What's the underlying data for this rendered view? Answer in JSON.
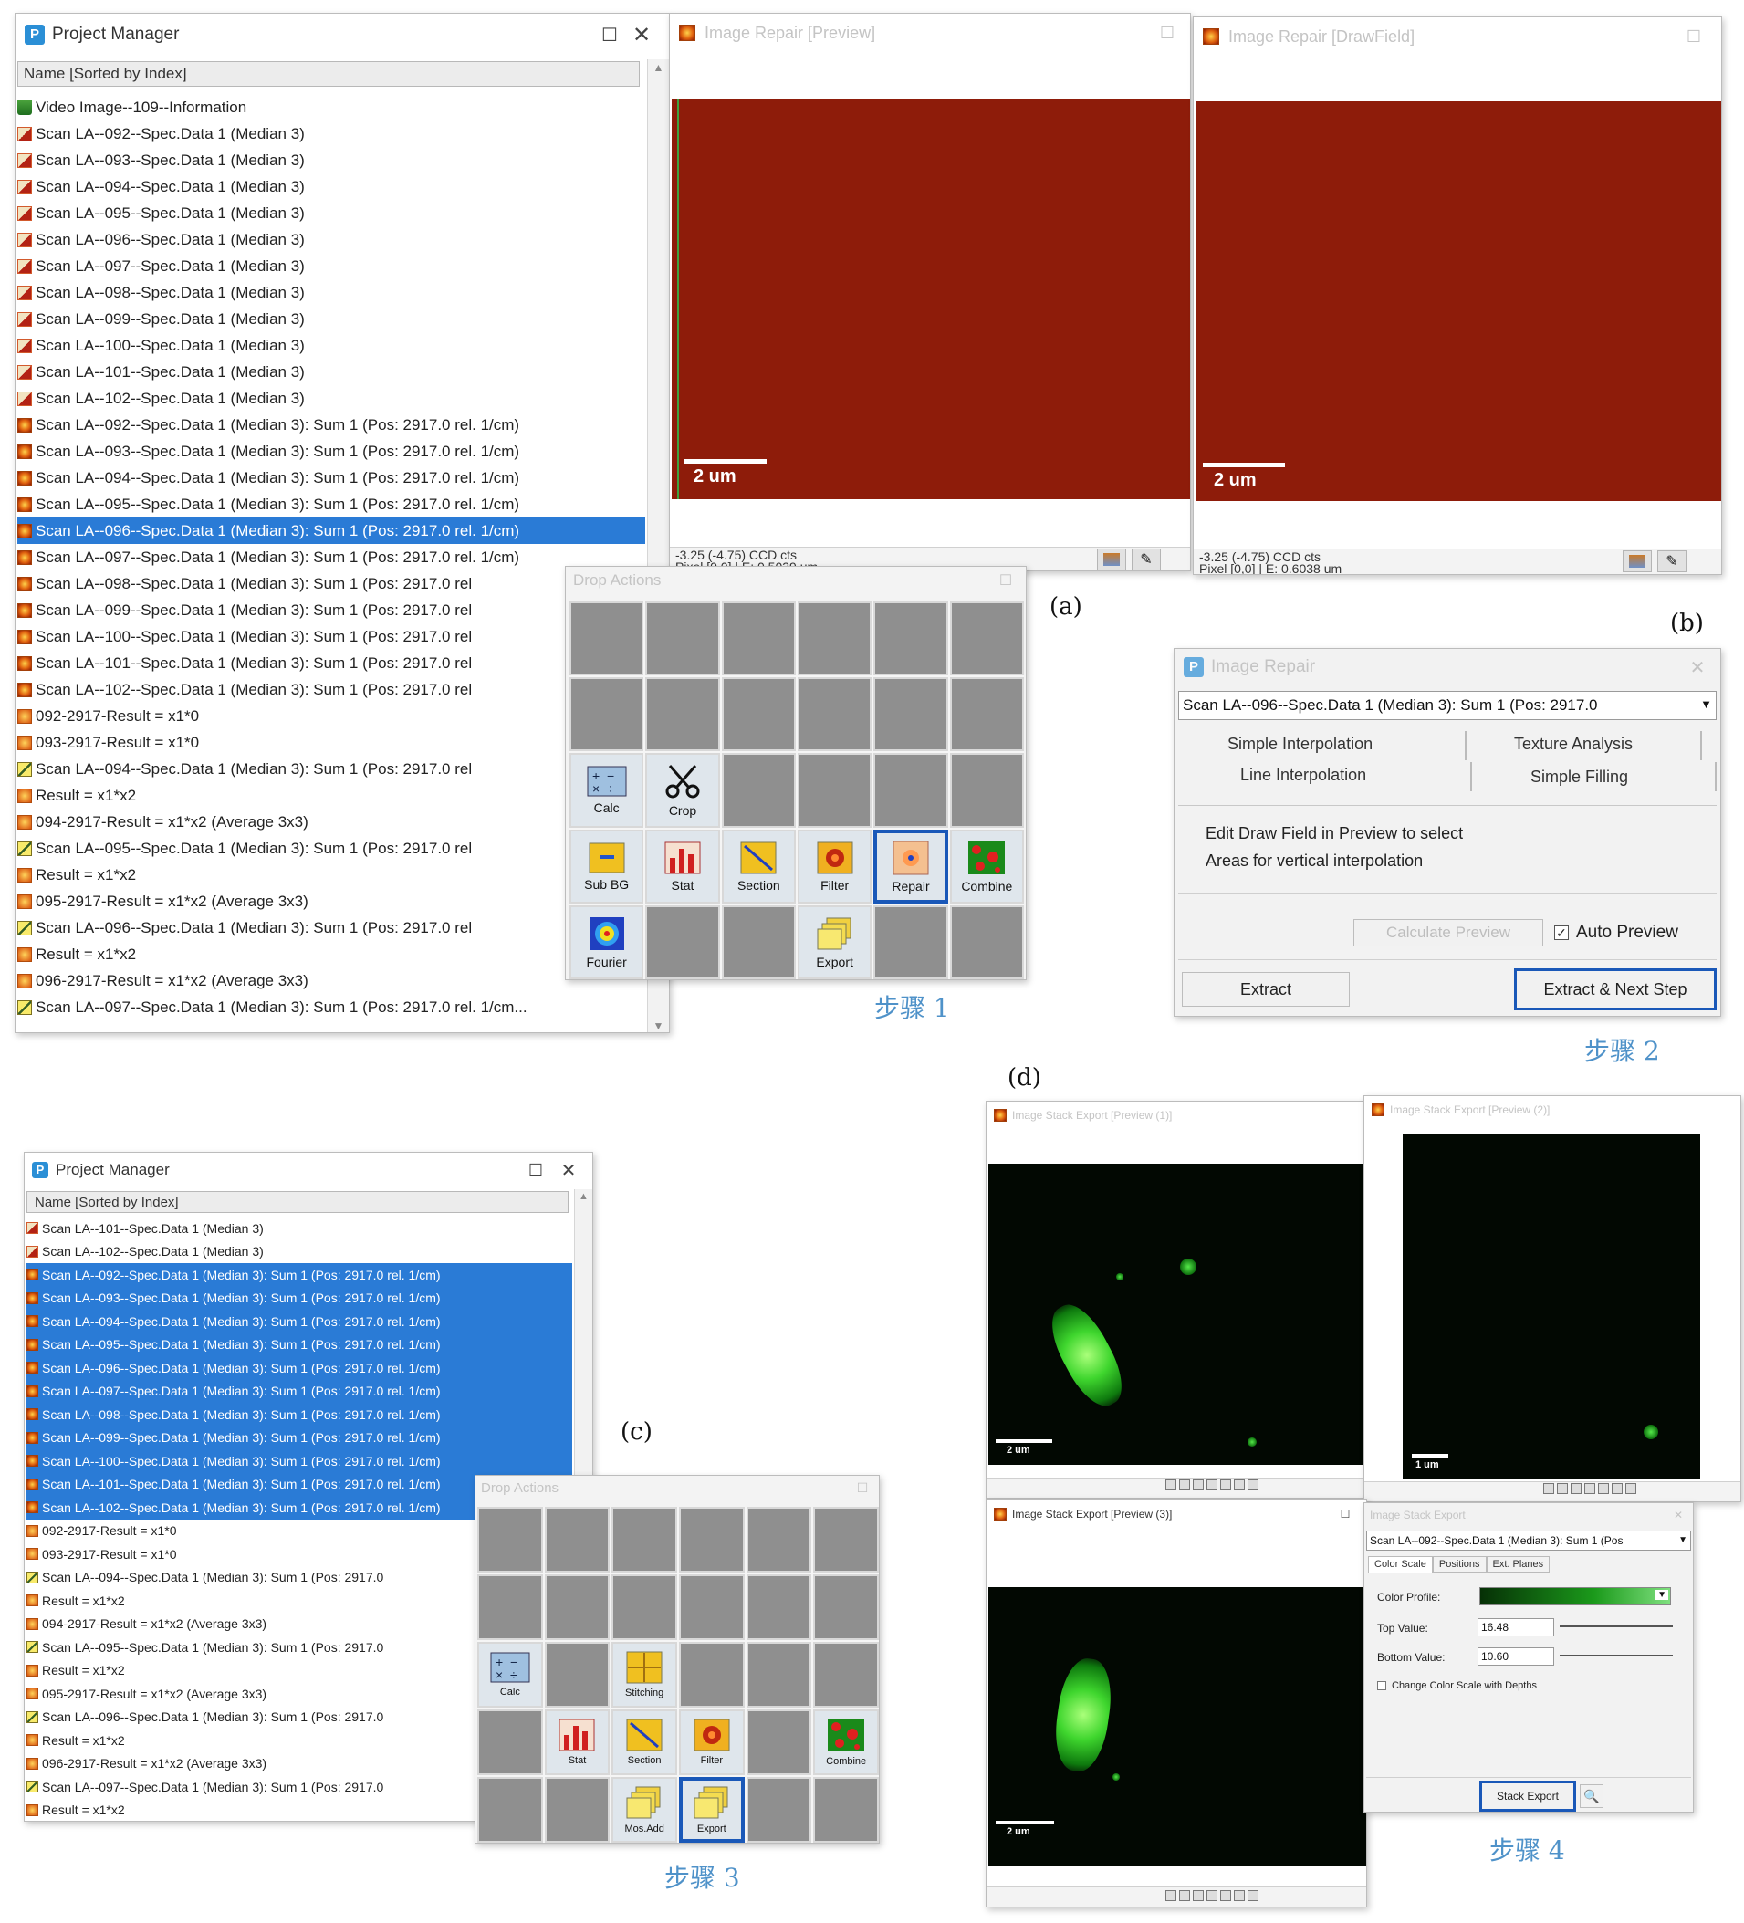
{
  "panel_labels": {
    "a": "(a)",
    "b": "(b)",
    "c": "(c)",
    "d": "(d)"
  },
  "steps": {
    "s1": "步骤 1",
    "s2": "步骤 2",
    "s3": "步骤 3",
    "s4": "步骤 4"
  },
  "pm_top": {
    "title": "Project Manager",
    "column_header": "Name [Sorted by Index]",
    "items": [
      {
        "text": "Video Image--109--Information",
        "icon": "info"
      },
      {
        "text": "Scan LA--092--Spec.Data 1 (Median 3)",
        "icon": "scan"
      },
      {
        "text": "Scan LA--093--Spec.Data 1 (Median 3)",
        "icon": "scan"
      },
      {
        "text": "Scan LA--094--Spec.Data 1 (Median 3)",
        "icon": "scan"
      },
      {
        "text": "Scan LA--095--Spec.Data 1 (Median 3)",
        "icon": "scan"
      },
      {
        "text": "Scan LA--096--Spec.Data 1 (Median 3)",
        "icon": "scan"
      },
      {
        "text": "Scan LA--097--Spec.Data 1 (Median 3)",
        "icon": "scan"
      },
      {
        "text": "Scan LA--098--Spec.Data 1 (Median 3)",
        "icon": "scan"
      },
      {
        "text": "Scan LA--099--Spec.Data 1 (Median 3)",
        "icon": "scan"
      },
      {
        "text": "Scan LA--100--Spec.Data 1 (Median 3)",
        "icon": "scan"
      },
      {
        "text": "Scan LA--101--Spec.Data 1 (Median 3)",
        "icon": "scan"
      },
      {
        "text": "Scan LA--102--Spec.Data 1 (Median 3)",
        "icon": "scan"
      },
      {
        "text": "Scan LA--092--Spec.Data 1 (Median 3): Sum 1 (Pos: 2917.0 rel. 1/cm)",
        "icon": "sum"
      },
      {
        "text": "Scan LA--093--Spec.Data 1 (Median 3): Sum 1 (Pos: 2917.0 rel. 1/cm)",
        "icon": "sum"
      },
      {
        "text": "Scan LA--094--Spec.Data 1 (Median 3): Sum 1 (Pos: 2917.0 rel. 1/cm)",
        "icon": "sum"
      },
      {
        "text": "Scan LA--095--Spec.Data 1 (Median 3): Sum 1 (Pos: 2917.0 rel. 1/cm)",
        "icon": "sum"
      },
      {
        "text": "Scan LA--096--Spec.Data 1 (Median 3): Sum 1 (Pos: 2917.0 rel. 1/cm)",
        "icon": "sum",
        "selected": true
      },
      {
        "text": "Scan LA--097--Spec.Data 1 (Median 3): Sum 1 (Pos: 2917.0 rel. 1/cm)",
        "icon": "sum"
      },
      {
        "text": "Scan LA--098--Spec.Data 1 (Median 3): Sum 1 (Pos: 2917.0 rel",
        "icon": "sum"
      },
      {
        "text": "Scan LA--099--Spec.Data 1 (Median 3): Sum 1 (Pos: 2917.0 rel",
        "icon": "sum"
      },
      {
        "text": "Scan LA--100--Spec.Data 1 (Median 3): Sum 1 (Pos: 2917.0 rel",
        "icon": "sum"
      },
      {
        "text": "Scan LA--101--Spec.Data 1 (Median 3): Sum 1 (Pos: 2917.0 rel",
        "icon": "sum"
      },
      {
        "text": "Scan LA--102--Spec.Data 1 (Median 3): Sum 1 (Pos: 2917.0 rel",
        "icon": "sum"
      },
      {
        "text": "092-2917-Result = x1*0",
        "icon": "res"
      },
      {
        "text": "093-2917-Result = x1*0",
        "icon": "res"
      },
      {
        "text": "Scan LA--094--Spec.Data 1 (Median 3): Sum 1 (Pos: 2917.0 rel",
        "icon": "chan"
      },
      {
        "text": "Result = x1*x2",
        "icon": "res"
      },
      {
        "text": "094-2917-Result = x1*x2 (Average 3x3)",
        "icon": "res"
      },
      {
        "text": "Scan LA--095--Spec.Data 1 (Median 3): Sum 1 (Pos: 2917.0 rel",
        "icon": "chan"
      },
      {
        "text": "Result = x1*x2",
        "icon": "res"
      },
      {
        "text": "095-2917-Result = x1*x2 (Average 3x3)",
        "icon": "res"
      },
      {
        "text": "Scan LA--096--Spec.Data 1 (Median 3): Sum 1 (Pos: 2917.0 rel",
        "icon": "chan"
      },
      {
        "text": "Result = x1*x2",
        "icon": "res"
      },
      {
        "text": "096-2917-Result = x1*x2 (Average 3x3)",
        "icon": "res"
      },
      {
        "text": "Scan LA--097--Spec.Data 1 (Median 3): Sum 1 (Pos: 2917.0 rel. 1/cm...",
        "icon": "chan"
      }
    ]
  },
  "repair_preview": {
    "title": "Image Repair [Preview]",
    "scale": "2 um",
    "status1": "-3.25 (-4.75) CCD cts",
    "status2": "Pixel [0,0] | E: 0.5039 um"
  },
  "repair_drawfield": {
    "title": "Image Repair [DrawField]",
    "scale": "2 um",
    "status1": "-3.25 (-4.75) CCD cts",
    "status2": "Pixel [0,0] | E: 0.6038 um"
  },
  "drop_actions_1": {
    "title": "Drop Actions",
    "cells": [
      "",
      "",
      "",
      "",
      "",
      "",
      "",
      "",
      "",
      "",
      "",
      "",
      "Calc",
      "Crop",
      "",
      "",
      "",
      "",
      "Sub BG",
      "Stat",
      "Section",
      "Filter",
      "Repair",
      "Combine",
      "Fourier",
      "",
      "",
      "Export",
      "",
      ""
    ]
  },
  "image_repair": {
    "title": "Image Repair",
    "dropdown": "Scan LA--096--Spec.Data 1 (Median 3): Sum 1 (Pos: 2917.0",
    "tabs": [
      "Simple Interpolation",
      "Texture Analysis",
      "Line Interpolation",
      "Simple Filling"
    ],
    "desc1": "Edit Draw Field in Preview to select",
    "desc2": "Areas for vertical interpolation",
    "calc_preview": "Calculate Preview",
    "auto_preview": "Auto Preview",
    "auto_preview_checked": true,
    "extract": "Extract",
    "extract_next": "Extract & Next Step"
  },
  "pm_bottom": {
    "title": "Project Manager",
    "column_header": "Name [Sorted by Index]",
    "items": [
      {
        "text": "Scan LA--101--Spec.Data 1 (Median 3)",
        "icon": "scan"
      },
      {
        "text": "Scan LA--102--Spec.Data 1 (Median 3)",
        "icon": "scan"
      },
      {
        "text": "Scan LA--092--Spec.Data 1 (Median 3): Sum 1 (Pos: 2917.0 rel. 1/cm)",
        "icon": "sum",
        "selected": true
      },
      {
        "text": "Scan LA--093--Spec.Data 1 (Median 3): Sum 1 (Pos: 2917.0 rel. 1/cm)",
        "icon": "sum",
        "selected": true
      },
      {
        "text": "Scan LA--094--Spec.Data 1 (Median 3): Sum 1 (Pos: 2917.0 rel. 1/cm)",
        "icon": "sum",
        "selected": true
      },
      {
        "text": "Scan LA--095--Spec.Data 1 (Median 3): Sum 1 (Pos: 2917.0 rel. 1/cm)",
        "icon": "sum",
        "selected": true
      },
      {
        "text": "Scan LA--096--Spec.Data 1 (Median 3): Sum 1 (Pos: 2917.0 rel. 1/cm)",
        "icon": "sum",
        "selected": true
      },
      {
        "text": "Scan LA--097--Spec.Data 1 (Median 3): Sum 1 (Pos: 2917.0 rel. 1/cm)",
        "icon": "sum",
        "selected": true
      },
      {
        "text": "Scan LA--098--Spec.Data 1 (Median 3): Sum 1 (Pos: 2917.0 rel. 1/cm)",
        "icon": "sum",
        "selected": true
      },
      {
        "text": "Scan LA--099--Spec.Data 1 (Median 3): Sum 1 (Pos: 2917.0 rel. 1/cm)",
        "icon": "sum",
        "selected": true
      },
      {
        "text": "Scan LA--100--Spec.Data 1 (Median 3): Sum 1 (Pos: 2917.0 rel. 1/cm)",
        "icon": "sum",
        "selected": true
      },
      {
        "text": "Scan LA--101--Spec.Data 1 (Median 3): Sum 1 (Pos: 2917.0 rel. 1/cm)",
        "icon": "sum",
        "selected": true
      },
      {
        "text": "Scan LA--102--Spec.Data 1 (Median 3): Sum 1 (Pos: 2917.0 rel. 1/cm)",
        "icon": "sum",
        "selected": true
      },
      {
        "text": "092-2917-Result = x1*0",
        "icon": "res"
      },
      {
        "text": "093-2917-Result = x1*0",
        "icon": "res"
      },
      {
        "text": "Scan LA--094--Spec.Data 1 (Median 3): Sum 1 (Pos: 2917.0",
        "icon": "chan"
      },
      {
        "text": "Result = x1*x2",
        "icon": "res"
      },
      {
        "text": "094-2917-Result = x1*x2 (Average 3x3)",
        "icon": "res"
      },
      {
        "text": "Scan LA--095--Spec.Data 1 (Median 3): Sum 1 (Pos: 2917.0",
        "icon": "chan"
      },
      {
        "text": "Result = x1*x2",
        "icon": "res"
      },
      {
        "text": "095-2917-Result = x1*x2 (Average 3x3)",
        "icon": "res"
      },
      {
        "text": "Scan LA--096--Spec.Data 1 (Median 3): Sum 1 (Pos: 2917.0",
        "icon": "chan"
      },
      {
        "text": "Result = x1*x2",
        "icon": "res"
      },
      {
        "text": "096-2917-Result = x1*x2 (Average 3x3)",
        "icon": "res"
      },
      {
        "text": "Scan LA--097--Spec.Data 1 (Median 3): Sum 1 (Pos: 2917.0",
        "icon": "chan"
      },
      {
        "text": "Result = x1*x2",
        "icon": "res"
      }
    ]
  },
  "drop_actions_2": {
    "title": "Drop Actions",
    "cells": [
      "",
      "",
      "",
      "",
      "",
      "",
      "",
      "",
      "",
      "",
      "",
      "",
      "Calc",
      "",
      "Stitching",
      "",
      "",
      "",
      "",
      "Stat",
      "Section",
      "Filter",
      "",
      "Combine",
      "",
      "",
      "Mos.Add",
      "Export",
      "",
      ""
    ]
  },
  "stack_pc1": {
    "title": "Image Stack Export [Preview (1)]",
    "scale": "2 um"
  },
  "stack_pc2": {
    "title": "Image Stack Export [Preview (2)]",
    "scale": "1 um"
  },
  "stack_pc3": {
    "title": "Image Stack Export [Preview (3)]",
    "scale": "2 um"
  },
  "stack_export": {
    "title": "Image Stack Export",
    "dropdown": "Scan LA--092--Spec.Data 1 (Median 3): Sum 1 (Pos",
    "tabs": [
      "Color Scale",
      "Positions",
      "Ext. Planes"
    ],
    "color_profile_label": "Color Profile:",
    "top_value_label": "Top Value:",
    "top_value": "16.48",
    "bottom_value_label": "Bottom Value:",
    "bottom_value": "10.60",
    "checkbox_label": "Change Color Scale with Depths",
    "export_button": "Stack Export"
  }
}
